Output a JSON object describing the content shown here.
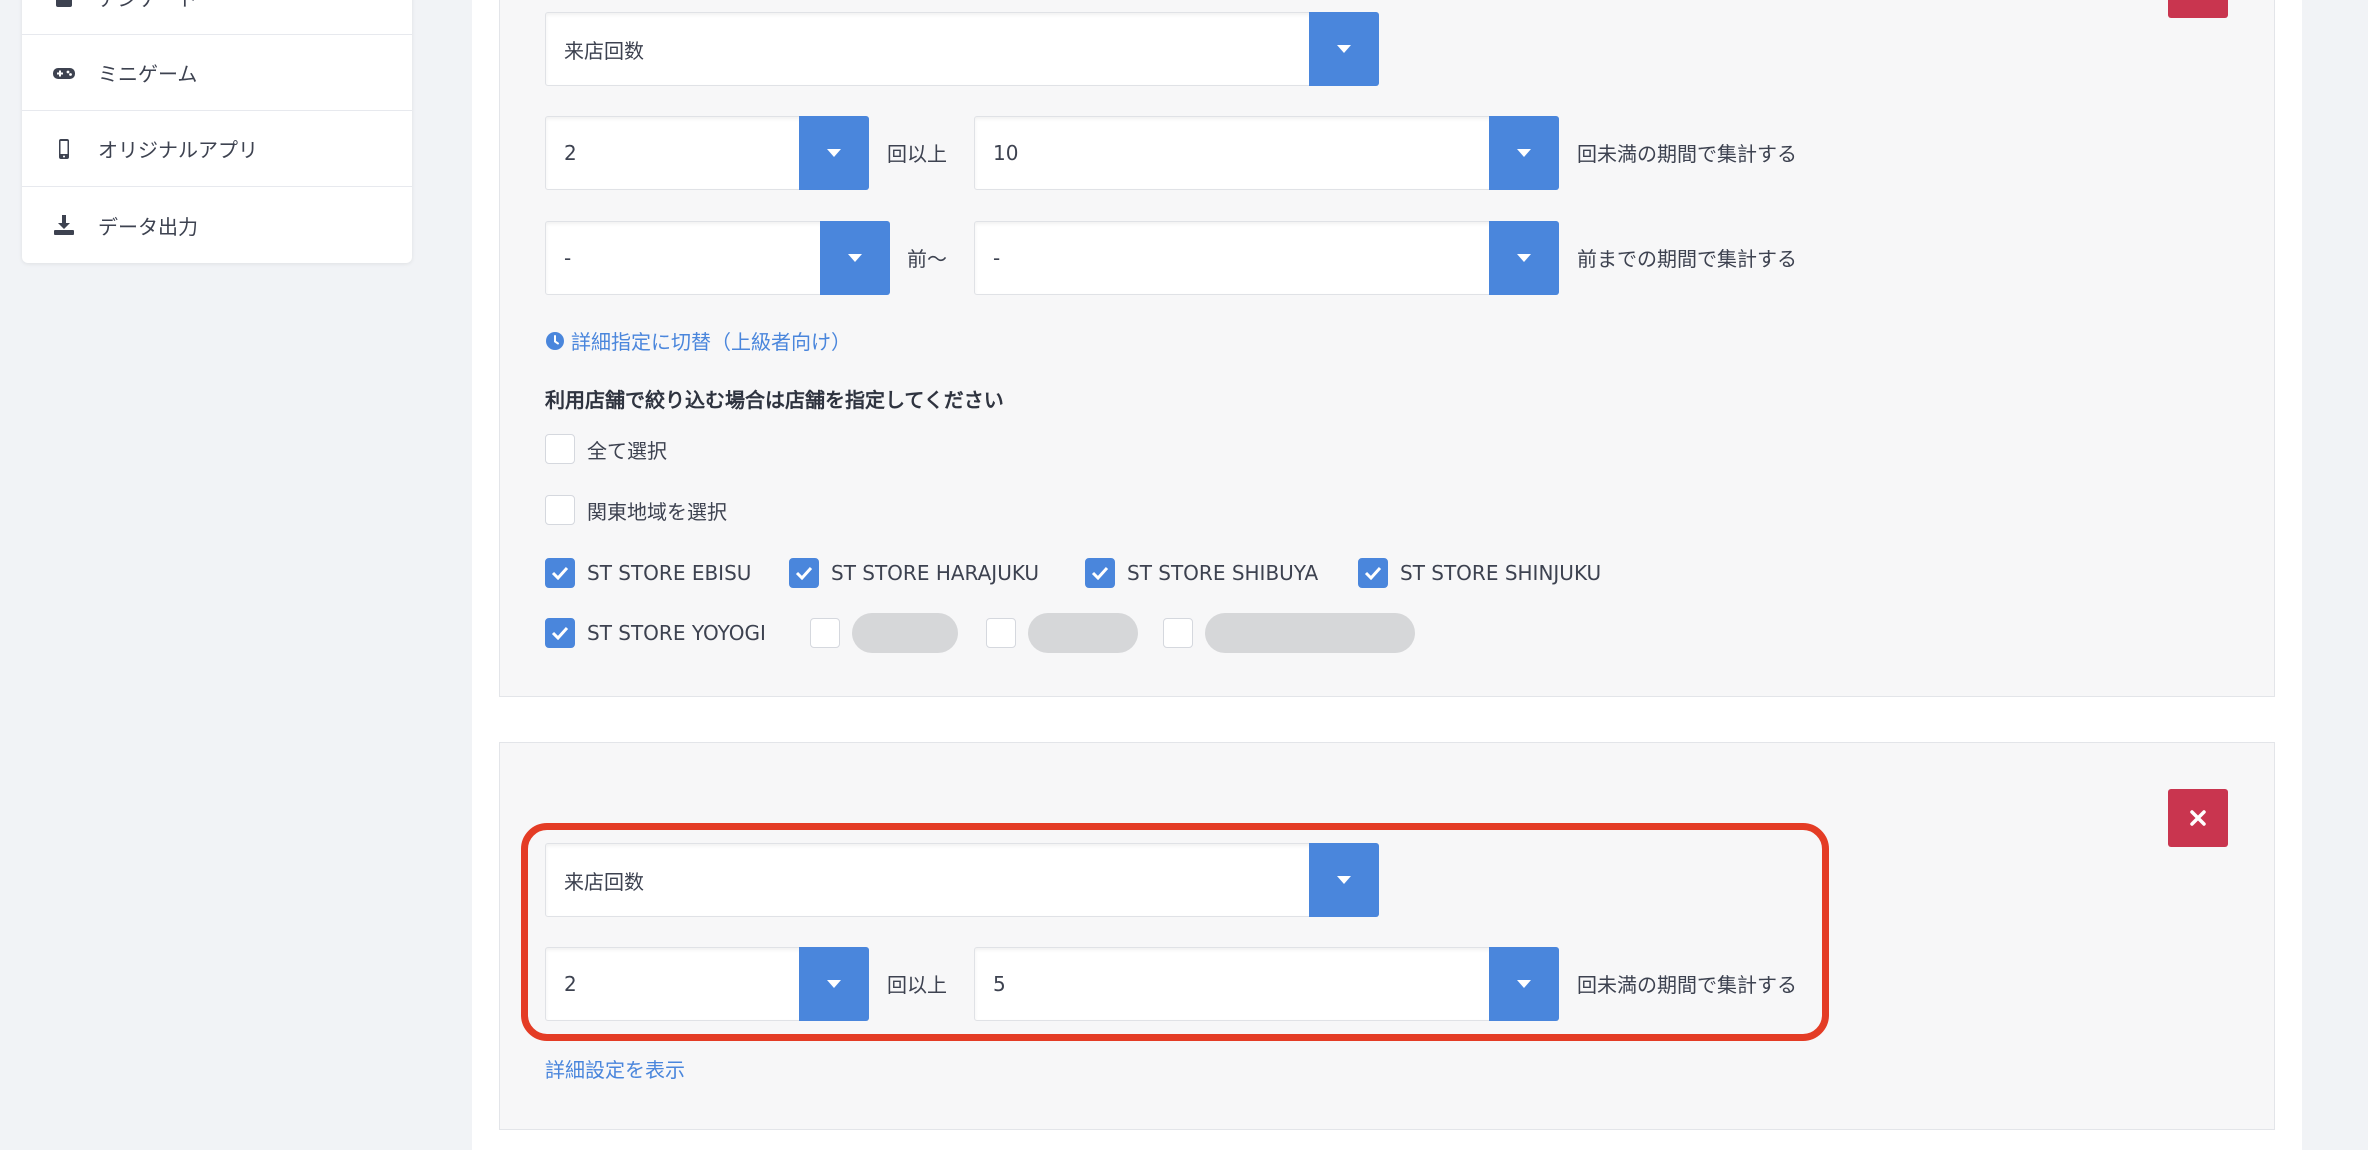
{
  "sidebar": {
    "items": [
      {
        "label": "アンケート",
        "icon": "survey-icon"
      },
      {
        "label": "ミニゲーム",
        "icon": "gamepad-icon"
      },
      {
        "label": "オリジナルアプリ",
        "icon": "smartphone-icon"
      },
      {
        "label": "データ出力",
        "icon": "download-icon"
      }
    ]
  },
  "condition1": {
    "type_select": "来店回数",
    "count_min": "2",
    "count_min_suffix": "回以上",
    "count_max": "10",
    "count_max_suffix": "回未満の期間で集計する",
    "period_from": "-",
    "period_from_suffix": "前〜",
    "period_to": "-",
    "period_to_suffix": "前までの期間で集計する",
    "advanced_link": "詳細指定に切替（上級者向け）",
    "store_heading": "利用店舗で絞り込む場合は店舗を指定してください",
    "select_all": "全て選択",
    "select_kanto": "関東地域を選択",
    "stores": [
      {
        "label": "ST STORE EBISU",
        "checked": true
      },
      {
        "label": "ST STORE HARAJUKU",
        "checked": true
      },
      {
        "label": "ST STORE SHIBUYA",
        "checked": true
      },
      {
        "label": "ST STORE SHINJUKU",
        "checked": true
      },
      {
        "label": "ST STORE YOYOGI",
        "checked": true
      }
    ]
  },
  "condition2": {
    "type_select": "来店回数",
    "count_min": "2",
    "count_min_suffix": "回以上",
    "count_max": "5",
    "count_max_suffix": "回未満の期間で集計する",
    "detail_link": "詳細設定を表示"
  },
  "colors": {
    "accent": "#4a86dc",
    "danger": "#c9354f",
    "highlight": "#e43c25"
  }
}
